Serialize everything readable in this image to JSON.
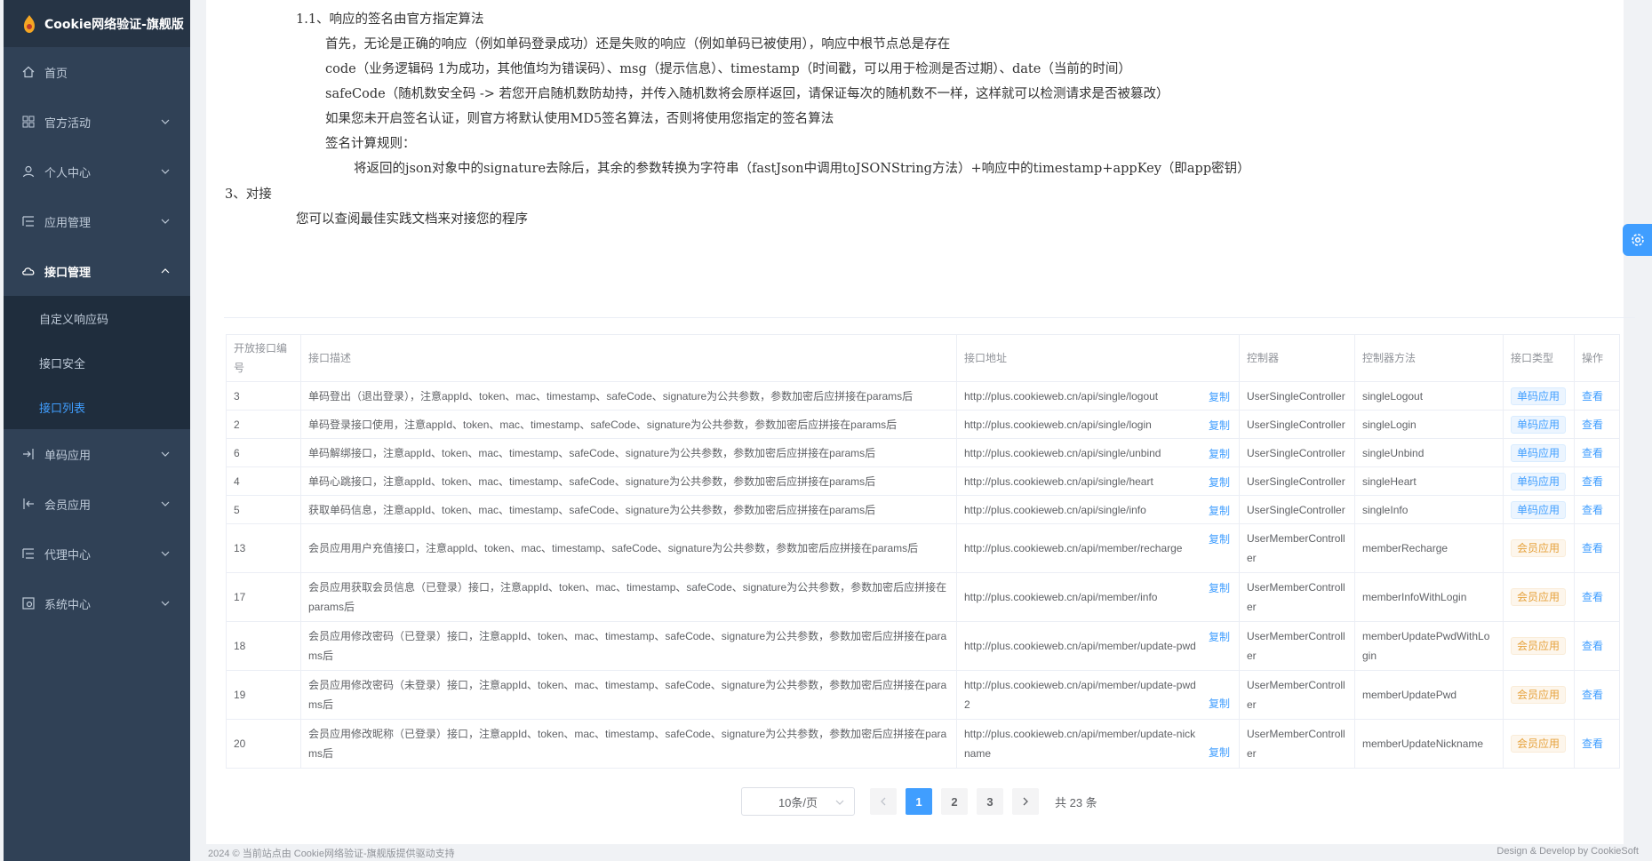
{
  "app": {
    "title": "Cookie网络验证-旗舰版"
  },
  "sidebar": {
    "items": [
      {
        "label": "首页"
      },
      {
        "label": "官方活动"
      },
      {
        "label": "个人中心"
      },
      {
        "label": "应用管理"
      },
      {
        "label": "接口管理"
      },
      {
        "label": "单码应用"
      },
      {
        "label": "会员应用"
      },
      {
        "label": "代理中心"
      },
      {
        "label": "系统中心"
      }
    ],
    "submenu": [
      {
        "label": "自定义响应码"
      },
      {
        "label": "接口安全"
      },
      {
        "label": "接口列表"
      }
    ]
  },
  "doc": {
    "lines": [
      "1.1、响应的签名由官方指定算法",
      "首先，无论是正确的响应（例如单码登录成功）还是失败的响应（例如单码已被使用），响应中根节点总是存在",
      "code（业务逻辑码 1为成功，其他值均为错误码）、msg（提示信息）、timestamp（时间戳，可以用于检测是否过期）、date（当前的时间）",
      "safeCode（随机数安全码 -> 若您开启随机数防劫持，并传入随机数将会原样返回，请保证每次的随机数不一样，这样就可以检测请求是否被篡改）",
      "如果您未开启签名认证，则官方将默认使用MD5签名算法，否则将使用您指定的签名算法",
      "签名计算规则：",
      "将返回的json对象中的signature去除后，其余的参数转换为字符串（fastJson中调用toJSONString方法）+响应中的timestamp+appKey（即app密钥）",
      "3、对接",
      "您可以查阅最佳实践文档来对接您的程序"
    ]
  },
  "table": {
    "headers": [
      "开放接口编号",
      "接口描述",
      "接口地址",
      "控制器",
      "控制器方法",
      "接口类型",
      "操作"
    ],
    "copy_label": "复制",
    "view_label": "查看",
    "rows": [
      {
        "id": "3",
        "desc": "单码登出（退出登录），注意appId、token、mac、timestamp、safeCode、signature为公共参数，参数加密后应拼接在params后",
        "url": "http://plus.cookieweb.cn/api/single/logout",
        "controller": "UserSingleController",
        "method": "singleLogout",
        "type": "单码应用",
        "kind": "single"
      },
      {
        "id": "2",
        "desc": "单码登录接口使用，注意appId、token、mac、timestamp、safeCode、signature为公共参数，参数加密后应拼接在params后",
        "url": "http://plus.cookieweb.cn/api/single/login",
        "controller": "UserSingleController",
        "method": "singleLogin",
        "type": "单码应用",
        "kind": "single"
      },
      {
        "id": "6",
        "desc": "单码解绑接口，注意appId、token、mac、timestamp、safeCode、signature为公共参数，参数加密后应拼接在params后",
        "url": "http://plus.cookieweb.cn/api/single/unbind",
        "controller": "UserSingleController",
        "method": "singleUnbind",
        "type": "单码应用",
        "kind": "single"
      },
      {
        "id": "4",
        "desc": "单码心跳接口，注意appId、token、mac、timestamp、safeCode、signature为公共参数，参数加密后应拼接在params后",
        "url": "http://plus.cookieweb.cn/api/single/heart",
        "controller": "UserSingleController",
        "method": "singleHeart",
        "type": "单码应用",
        "kind": "single"
      },
      {
        "id": "5",
        "desc": "获取单码信息，注意appId、token、mac、timestamp、safeCode、signature为公共参数，参数加密后应拼接在params后",
        "url": "http://plus.cookieweb.cn/api/single/info",
        "controller": "UserSingleController",
        "method": "singleInfo",
        "type": "单码应用",
        "kind": "single"
      },
      {
        "id": "13",
        "desc": "会员应用用户充值接口，注意appId、token、mac、timestamp、safeCode、signature为公共参数，参数加密后应拼接在params后",
        "url": "http://plus.cookieweb.cn/api/member/recharge",
        "controller": "UserMemberController",
        "method": "memberRecharge",
        "type": "会员应用",
        "kind": "member"
      },
      {
        "id": "17",
        "desc": "会员应用获取会员信息（已登录）接口，注意appId、token、mac、timestamp、safeCode、signature为公共参数，参数加密后应拼接在params后",
        "url": "http://plus.cookieweb.cn/api/member/info",
        "controller": "UserMemberController",
        "method": "memberInfoWithLogin",
        "type": "会员应用",
        "kind": "member"
      },
      {
        "id": "18",
        "desc": "会员应用修改密码（已登录）接口，注意appId、token、mac、timestamp、safeCode、signature为公共参数，参数加密后应拼接在params后",
        "url": "http://plus.cookieweb.cn/api/member/update-pwd",
        "controller": "UserMemberController",
        "method": "memberUpdatePwdWithLogin",
        "type": "会员应用",
        "kind": "member"
      },
      {
        "id": "19",
        "desc": "会员应用修改密码（未登录）接口，注意appId、token、mac、timestamp、safeCode、signature为公共参数，参数加密后应拼接在params后",
        "url": "http://plus.cookieweb.cn/api/member/update-pwd2",
        "controller": "UserMemberController",
        "method": "memberUpdatePwd",
        "type": "会员应用",
        "kind": "member"
      },
      {
        "id": "20",
        "desc": "会员应用修改昵称（已登录）接口，注意appId、token、mac、timestamp、safeCode、signature为公共参数，参数加密后应拼接在params后",
        "url": "http://plus.cookieweb.cn/api/member/update-nickname",
        "controller": "UserMemberController",
        "method": "memberUpdateNickname",
        "type": "会员应用",
        "kind": "member"
      }
    ]
  },
  "pagination": {
    "page_size": "10条/页",
    "pages": [
      "1",
      "2",
      "3"
    ],
    "current": "1",
    "total": "共 23 条"
  },
  "footer": {
    "left": "2024 © 当前站点由 Cookie网络验证-旗舰版提供驱动支持",
    "right": "Design & Develop by CookieSoft"
  },
  "colors": {
    "primary": "#409eff",
    "sidebar_bg": "#304156",
    "sidebar_submenu_bg": "#1f2d3d",
    "warning": "#e6a23c"
  }
}
